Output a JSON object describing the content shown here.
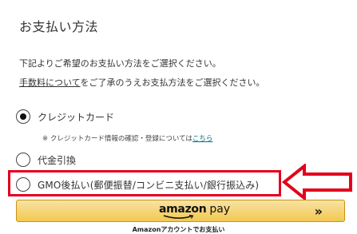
{
  "page": {
    "title": "お支払い方法"
  },
  "instructions": {
    "line1": "下記よりご希望のお支払い方法をご選択ください。",
    "fees_link": "手数料について",
    "line2_rest": "をご了承のうえお支払方法をご選択ください。"
  },
  "payment_options": [
    {
      "label": "クレジットカード",
      "checked": true
    },
    {
      "label": "代金引換",
      "checked": false
    },
    {
      "label": "GMO後払い(郵便振替/コンビニ支払い/銀行振込み)",
      "checked": false
    }
  ],
  "card_note": {
    "text": "※ クレジットカード情報の確認・登録については",
    "link": "こちら"
  },
  "amazon_pay": {
    "logo_amazon": "amazon",
    "logo_pay": "pay",
    "chevron": "»",
    "caption": "Amazonアカウントでお支払い"
  },
  "colors": {
    "highlight": "#e3001b",
    "button_top": "#f8e3a5",
    "button_bottom": "#f2c94f",
    "link": "#007185"
  },
  "icons": {
    "arrow": "red-outline-arrow-pointing-left",
    "chevron": "double-chevron-right-icon"
  }
}
